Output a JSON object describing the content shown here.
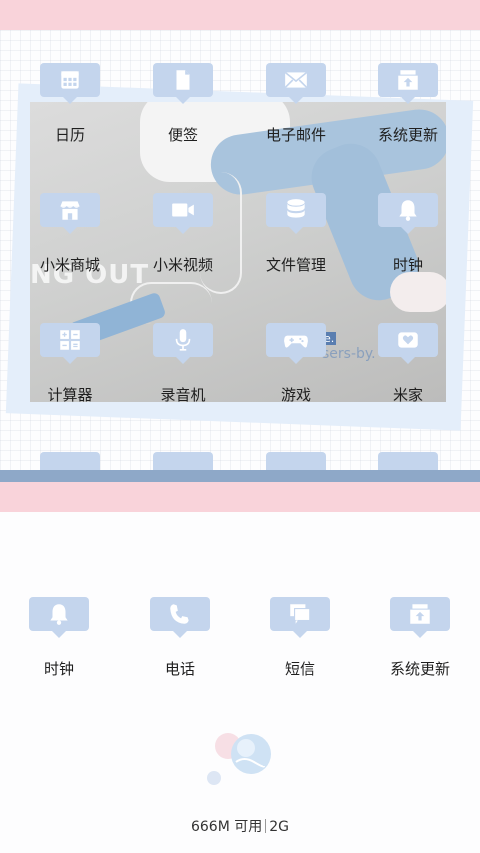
{
  "top_grid": [
    [
      {
        "label": "日历",
        "icon": "calendar-icon"
      },
      {
        "label": "便签",
        "icon": "note-icon"
      },
      {
        "label": "电子邮件",
        "icon": "mail-icon"
      },
      {
        "label": "系统更新",
        "icon": "system-update-icon"
      }
    ],
    [
      {
        "label": "小米商城",
        "icon": "store-icon"
      },
      {
        "label": "小米视频",
        "icon": "video-camera-icon"
      },
      {
        "label": "文件管理",
        "icon": "database-icon"
      },
      {
        "label": "时钟",
        "icon": "bell-icon"
      }
    ],
    [
      {
        "label": "计算器",
        "icon": "calculator-icon"
      },
      {
        "label": "录音机",
        "icon": "microphone-icon"
      },
      {
        "label": "游戏",
        "icon": "gamepad-icon"
      },
      {
        "label": "米家",
        "icon": "heart-home-icon"
      }
    ]
  ],
  "dock": [
    {
      "label": "时钟",
      "icon": "bell-icon"
    },
    {
      "label": "电话",
      "icon": "phone-icon"
    },
    {
      "label": "短信",
      "icon": "message-icon"
    },
    {
      "label": "系统更新",
      "icon": "system-update-icon"
    }
  ],
  "wallpaper": {
    "graffiti_text": "NG OUT",
    "sticker_text": "sers-by.",
    "sticker_badge": "e."
  },
  "memory": {
    "available": "666M 可用",
    "total": "2G"
  },
  "colors": {
    "accent": "#c4d5ed",
    "pink": "#f9d3da",
    "blue_band": "#8ea8c8"
  }
}
